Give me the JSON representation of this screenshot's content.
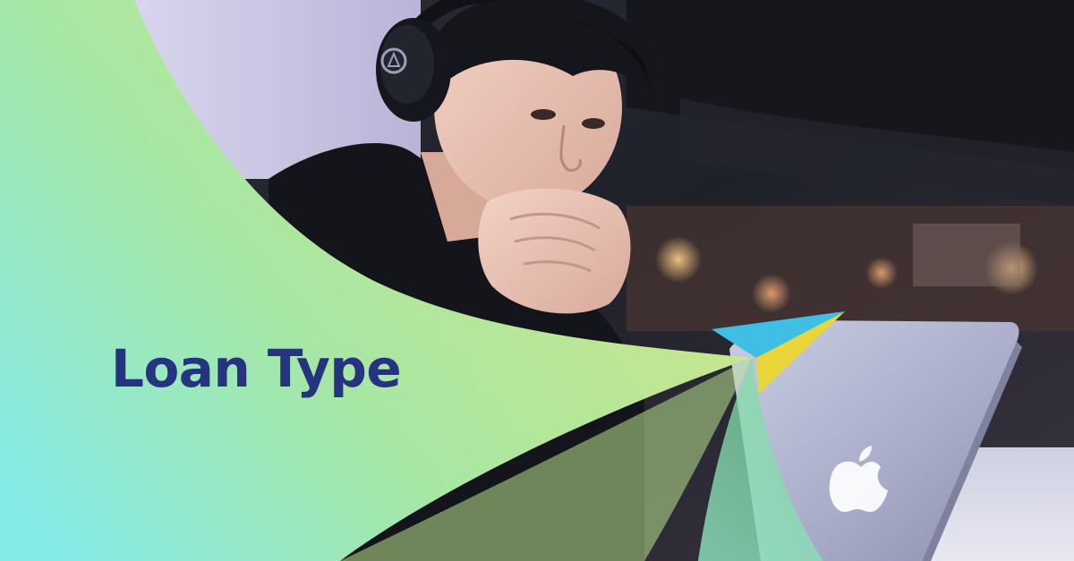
{
  "headline": {
    "text": "Loan Type"
  },
  "colors": {
    "headline": "#26337f",
    "gradient_start": "#86eae6",
    "gradient_mid": "#a7e7a4",
    "gradient_end": "#cde68b",
    "accent_blue": "#3fbfe4",
    "accent_yellow": "#e9d63a"
  },
  "icons": {
    "brand_mark": "paper-plane-icon",
    "laptop_logo": "apple-logo-icon",
    "headphone_logo": "headphone-brand-logo"
  }
}
